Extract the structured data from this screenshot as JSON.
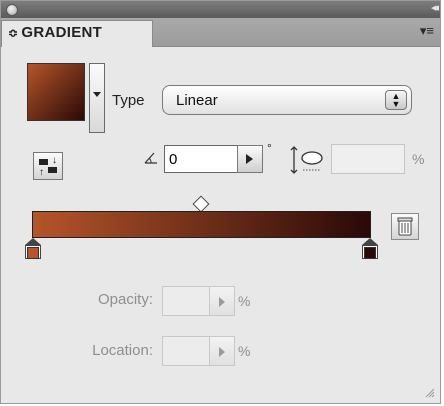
{
  "panel": {
    "title": "GRADIENT",
    "tab_arrows": "≎",
    "collapse_glyph": "◂◂",
    "menu_glyph": "▾≡"
  },
  "gradient": {
    "type_label": "Type",
    "type_value": "Linear",
    "angle": "0",
    "degree_symbol": "°",
    "aspect_ratio": "",
    "aspect_unit": "%",
    "start_color": "#b5552a",
    "end_color": "#2a0907"
  },
  "stops": [
    {
      "location": 0,
      "color": "#b5552a"
    },
    {
      "location": 100,
      "color": "#2a0907"
    }
  ],
  "midpoint": {
    "location": 50
  },
  "fields": {
    "opacity_label": "Opacity:",
    "opacity_value": "",
    "opacity_unit": "%",
    "location_label": "Location:",
    "location_value": "",
    "location_unit": "%"
  },
  "icons": {
    "reverse": "reverse-gradient-icon",
    "angle": "angle-icon",
    "aspect": "aspect-ratio-icon",
    "trash": "trash-icon",
    "grip": "resize-grip-icon"
  }
}
